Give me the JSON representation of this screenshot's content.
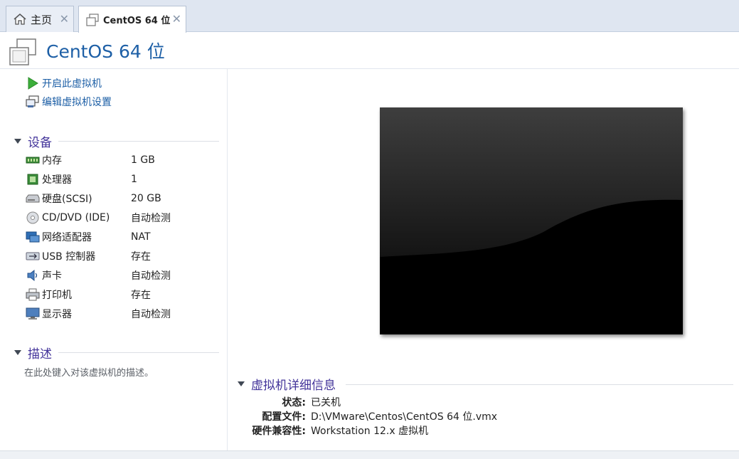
{
  "tabs": [
    {
      "label": "主页",
      "icon": "home-icon"
    },
    {
      "label": "CentOS 64 位",
      "icon": "vm-icon"
    }
  ],
  "header": {
    "title": "CentOS 64 位"
  },
  "actions": [
    {
      "label": "开启此虚拟机",
      "icon": "play-icon"
    },
    {
      "label": "编辑虚拟机设置",
      "icon": "edit-settings-icon"
    }
  ],
  "devices": {
    "title": "设备",
    "items": [
      {
        "name": "内存",
        "value": "1 GB",
        "icon": "memory-icon"
      },
      {
        "name": "处理器",
        "value": "1",
        "icon": "processor-icon"
      },
      {
        "name": "硬盘(SCSI)",
        "value": "20 GB",
        "icon": "harddisk-icon"
      },
      {
        "name": "CD/DVD (IDE)",
        "value": "自动检测",
        "icon": "cd-dvd-icon"
      },
      {
        "name": "网络适配器",
        "value": "NAT",
        "icon": "network-adapter-icon"
      },
      {
        "name": "USB 控制器",
        "value": "存在",
        "icon": "usb-icon"
      },
      {
        "name": "声卡",
        "value": "自动检测",
        "icon": "sound-card-icon"
      },
      {
        "name": "打印机",
        "value": "存在",
        "icon": "printer-icon"
      },
      {
        "name": "显示器",
        "value": "自动检测",
        "icon": "display-icon"
      }
    ]
  },
  "description": {
    "title": "描述",
    "placeholder": "在此处键入对该虚拟机的描述。"
  },
  "details": {
    "title": "虚拟机详细信息",
    "rows": [
      {
        "key": "状态:",
        "value": "已关机"
      },
      {
        "key": "配置文件:",
        "value": "D:\\VMware\\Centos\\CentOS 64 位.vmx"
      },
      {
        "key": "硬件兼容性:",
        "value": "Workstation 12.x 虚拟机"
      }
    ]
  },
  "colors": {
    "title_blue": "#1d5fa6",
    "section_purple": "#43349a",
    "tabbar_bg": "#dfe6f1"
  }
}
